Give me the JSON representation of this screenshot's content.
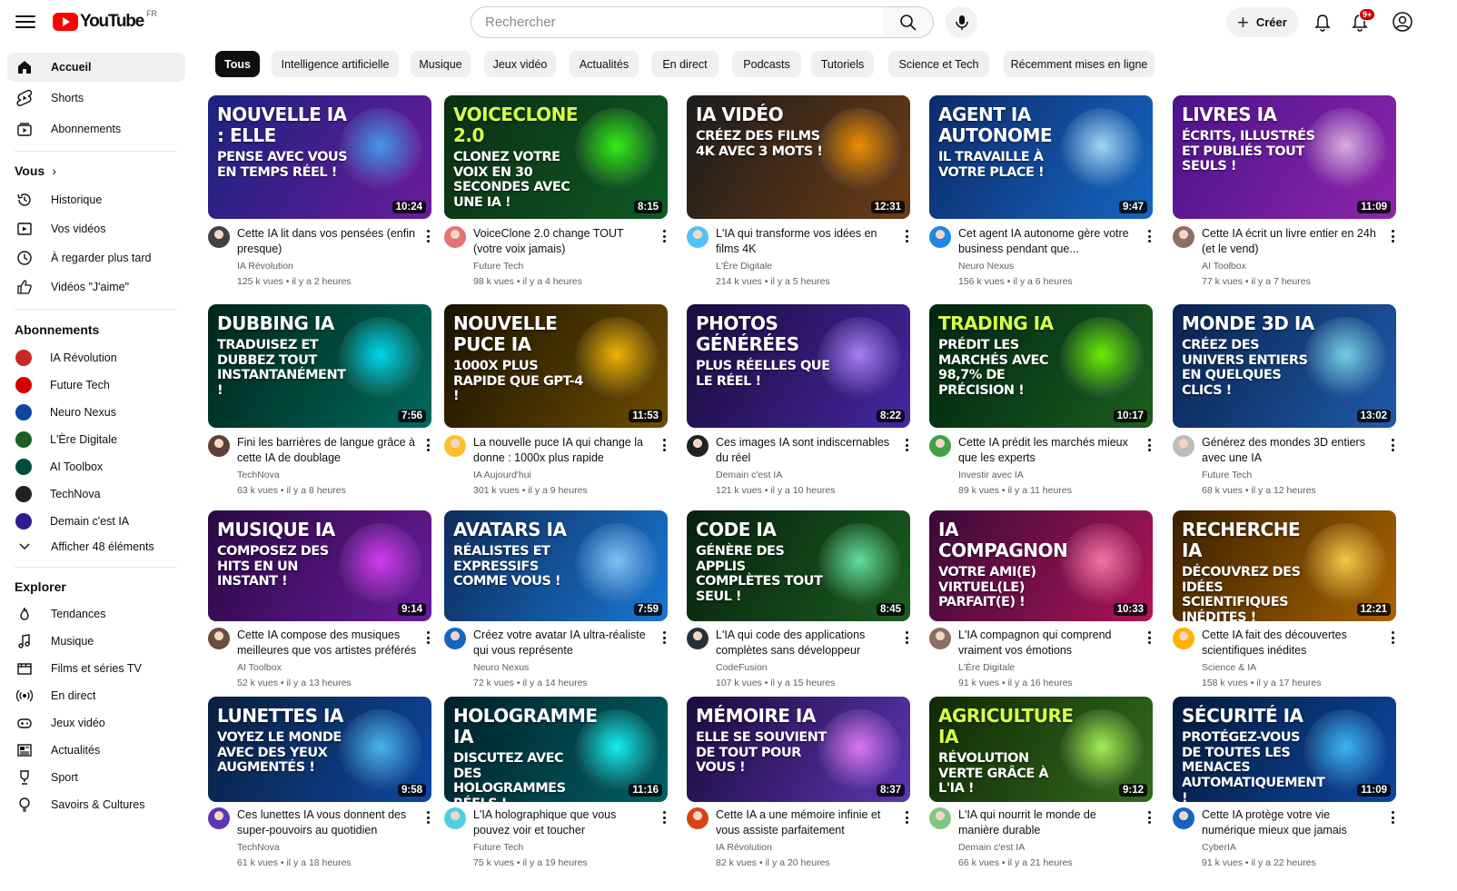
{
  "header": {
    "logo_text": "YouTube",
    "country_code": "FR",
    "search_placeholder": "Rechercher",
    "create_label": "Créer",
    "notification_count": "9+"
  },
  "sidebar": {
    "main": [
      {
        "label": "Accueil",
        "icon": "home-icon"
      },
      {
        "label": "Shorts",
        "icon": "shorts-icon"
      },
      {
        "label": "Abonnements",
        "icon": "subscriptions-icon"
      }
    ],
    "you_title": "Vous",
    "you": [
      {
        "label": "Historique",
        "icon": "history-icon"
      },
      {
        "label": "Vos vidéos",
        "icon": "your-videos-icon"
      },
      {
        "label": "À regarder plus tard",
        "icon": "watch-later-icon"
      },
      {
        "label": "Vidéos \"J'aime\"",
        "icon": "like-icon"
      }
    ],
    "subs_title": "Abonnements",
    "subs": [
      {
        "label": "IA Révolution",
        "color": "#c62828"
      },
      {
        "label": "Future Tech",
        "color": "#d50000"
      },
      {
        "label": "Neuro Nexus",
        "color": "#0d47a1"
      },
      {
        "label": "L'Ère Digitale",
        "color": "#1b5e20"
      },
      {
        "label": "AI Toolbox",
        "color": "#004d40"
      },
      {
        "label": "TechNova",
        "color": "#212121"
      },
      {
        "label": "Demain c'est IA",
        "color": "#311b92"
      }
    ],
    "show_more": "Afficher 48 éléments",
    "explore_title": "Explorer",
    "explore": [
      {
        "label": "Tendances",
        "icon": "trending-icon"
      },
      {
        "label": "Musique",
        "icon": "music-icon"
      },
      {
        "label": "Films et séries TV",
        "icon": "movies-icon"
      },
      {
        "label": "En direct",
        "icon": "live-icon"
      },
      {
        "label": "Jeux vidéo",
        "icon": "gaming-icon"
      },
      {
        "label": "Actualités",
        "icon": "news-icon"
      },
      {
        "label": "Sport",
        "icon": "sports-icon"
      },
      {
        "label": "Savoirs & Cultures",
        "icon": "learning-icon"
      }
    ]
  },
  "chips": [
    "Tous",
    "Intelligence artificielle",
    "Musique",
    "Jeux vidéo",
    "Actualités",
    "En direct",
    "Podcasts",
    "Tutoriels",
    "Science et Tech",
    "Récemment mises en ligne"
  ],
  "videos": [
    {
      "thumb_title": "Nouvelle IA : elle",
      "thumb_sub": "pense avec vous en temps réel !",
      "duration": "10:24",
      "title": "Cette IA lit dans vos pensées (enfin presque)",
      "channel": "IA Révolution",
      "stats": "125 k vues • il y a 2 heures",
      "bg": "#1a237e",
      "bg2": "#6a1b9a",
      "accent": "#42a5f5",
      "avatar": "#424242"
    },
    {
      "thumb_title": "VoiceClone 2.0",
      "thumb_sub": "Clonez votre voix en 30 secondes avec une IA !",
      "duration": "8:15",
      "title": "VoiceClone 2.0 change TOUT (votre voix jamais)",
      "channel": "Future Tech",
      "stats": "98 k vues • il y a 4 heures",
      "bg": "#0b2e13",
      "bg2": "#0f5a24",
      "accent": "#39ff14",
      "avatar": "#e57373"
    },
    {
      "thumb_title": "IA Vidéo",
      "thumb_sub": "Créez des films 4K avec 3 mots !",
      "duration": "12:31",
      "title": "L'IA qui transforme vos idées en films 4K",
      "channel": "L'Ère Digitale",
      "stats": "214 k vues • il y a 5 heures",
      "bg": "#1c1c1c",
      "bg2": "#6d3c14",
      "accent": "#ff9800",
      "avatar": "#4fc3f7"
    },
    {
      "thumb_title": "Agent IA autonome",
      "thumb_sub": "Il travaille à votre place !",
      "duration": "9:47",
      "title": "Cet agent IA autonome gère votre business pendant que...",
      "channel": "Neuro Nexus",
      "stats": "156 k vues • il y a 6 heures",
      "bg": "#0d2b6b",
      "bg2": "#1565c0",
      "accent": "#b3e5fc",
      "avatar": "#1e88e5"
    },
    {
      "thumb_title": "Livres IA",
      "thumb_sub": "Écrits, illustrés et publiés tout seuls !",
      "duration": "11:09",
      "title": "Cette IA écrit un livre entier en 24h (et le vend)",
      "channel": "AI Toolbox",
      "stats": "77 k vues • il y a 7 heures",
      "bg": "#4a148c",
      "bg2": "#8e24aa",
      "accent": "#e1bee7",
      "avatar": "#8d6e63"
    },
    {
      "thumb_title": "Dubbing IA",
      "thumb_sub": "Traduisez et dubbez tout instantanément !",
      "duration": "7:56",
      "title": "Fini les barrières de langue grâce à cette IA de doublage",
      "channel": "TechNova",
      "stats": "63 k vues • il y a 8 heures",
      "bg": "#00251a",
      "bg2": "#00695c",
      "accent": "#00e5ff",
      "avatar": "#5d4037"
    },
    {
      "thumb_title": "Nouvelle puce IA",
      "thumb_sub": "1000x plus rapide que GPT-4 !",
      "duration": "11:53",
      "title": "La nouvelle puce IA qui change la donne : 1000x plus rapide",
      "channel": "IA Aujourd'hui",
      "stats": "301 k vues • il y a 9 heures",
      "bg": "#1a1200",
      "bg2": "#6d4c00",
      "accent": "#ffc107",
      "avatar": "#fbc02d"
    },
    {
      "thumb_title": "Photos générées",
      "thumb_sub": "plus réelles que le réel !",
      "duration": "8:22",
      "title": "Ces images IA sont indiscernables du réel",
      "channel": "Demain c'est IA",
      "stats": "121 k vues • il y a 10 heures",
      "bg": "#1a0b3d",
      "bg2": "#4527a0",
      "accent": "#b388ff",
      "avatar": "#212121"
    },
    {
      "thumb_title": "Trading IA",
      "thumb_sub": "Prédit les marchés avec 98,7% de précision !",
      "duration": "10:17",
      "title": "Cette IA prédit les marchés mieux que les experts",
      "channel": "Investir avec IA",
      "stats": "89 k vues • il y a 11 heures",
      "bg": "#002510",
      "bg2": "#1b5e20",
      "accent": "#76ff03",
      "avatar": "#43a047"
    },
    {
      "thumb_title": "Monde 3D IA",
      "thumb_sub": "Créez des univers entiers en quelques clics !",
      "duration": "13:02",
      "title": "Générez des mondes 3D entiers avec une IA",
      "channel": "Future Tech",
      "stats": "68 k vues • il y a 12 heures",
      "bg": "#0a2350",
      "bg2": "#1e5aa8",
      "accent": "#80deea",
      "avatar": "#bdbdbd"
    },
    {
      "thumb_title": "Musique IA",
      "thumb_sub": "Composez des hits en un instant !",
      "duration": "9:14",
      "title": "Cette IA compose des musiques meilleures que vos artistes préférés",
      "channel": "AI Toolbox",
      "stats": "52 k vues • il y a 13 heures",
      "bg": "#2a0845",
      "bg2": "#6a1b9a",
      "accent": "#e040fb",
      "avatar": "#6d4c41"
    },
    {
      "thumb_title": "Avatars IA",
      "thumb_sub": "Réalistes et expressifs comme vous !",
      "duration": "7:59",
      "title": "Créez votre avatar IA ultra-réaliste qui vous représente",
      "channel": "Neuro Nexus",
      "stats": "72 k vues • il y a 14 heures",
      "bg": "#0d2b5a",
      "bg2": "#1976d2",
      "accent": "#90caf9",
      "avatar": "#1565c0"
    },
    {
      "thumb_title": "Code IA",
      "thumb_sub": "Génère des applis complètes tout seul !",
      "duration": "8:45",
      "title": "L'IA qui code des applications complètes sans développeur",
      "channel": "CodeFusion",
      "stats": "107 k vues • il y a 15 heures",
      "bg": "#06200e",
      "bg2": "#1b5e20",
      "accent": "#69f0ae",
      "avatar": "#263238"
    },
    {
      "thumb_title": "IA Compagnon",
      "thumb_sub": "Votre ami(e) virtuel(le) parfait(e) !",
      "duration": "10:33",
      "title": "L'IA compagnon qui comprend vraiment vos émotions",
      "channel": "L'Ère Digitale",
      "stats": "91 k vues • il y a 16 heures",
      "bg": "#3a0a3a",
      "bg2": "#ad1457",
      "accent": "#ff80ab",
      "avatar": "#8d6e63"
    },
    {
      "thumb_title": "Recherche IA",
      "thumb_sub": "Découvrez des idées scientifiques inédites !",
      "duration": "12:21",
      "title": "Cette IA fait des découvertes scientifiques inédites",
      "channel": "Science & IA",
      "stats": "158 k vues • il y a 17 heures",
      "bg": "#3a2000",
      "bg2": "#a86400",
      "accent": "#ffd54f",
      "avatar": "#ffb300"
    },
    {
      "thumb_title": "Lunettes IA",
      "thumb_sub": "Voyez le monde avec des yeux augmentés !",
      "duration": "9:58",
      "title": "Ces lunettes IA vous donnent des super-pouvoirs au quotidien",
      "channel": "TechNova",
      "stats": "61 k vues • il y a 18 heures",
      "bg": "#0a1f3d",
      "bg2": "#0d47a1",
      "accent": "#4fc3f7",
      "avatar": "#5e35b1"
    },
    {
      "thumb_title": "Hologramme IA",
      "thumb_sub": "Discutez avec des hologrammes réels !",
      "duration": "11:16",
      "title": "L'IA holographique que vous pouvez voir et toucher",
      "channel": "Future Tech",
      "stats": "75 k vues • il y a 19 heures",
      "bg": "#00202a",
      "bg2": "#006064",
      "accent": "#18ffff",
      "avatar": "#4dd0e1"
    },
    {
      "thumb_title": "Mémoire IA",
      "thumb_sub": "Elle se souvient de tout pour vous !",
      "duration": "8:37",
      "title": "Cette IA a une mémoire infinie et vous assiste parfaitement",
      "channel": "IA Révolution",
      "stats": "82 k vues • il y a 20 heures",
      "bg": "#1a0a3d",
      "bg2": "#5e35b1",
      "accent": "#ea80fc",
      "avatar": "#d84315"
    },
    {
      "thumb_title": "Agriculture IA",
      "thumb_sub": "Révolution verte grâce à l'IA !",
      "duration": "9:12",
      "title": "L'IA qui nourrit le monde de manière durable",
      "channel": "Demain c'est IA",
      "stats": "66 k vues • il y a 21 heures",
      "bg": "#102a05",
      "bg2": "#33691e",
      "accent": "#b2ff59",
      "avatar": "#81c784"
    },
    {
      "thumb_title": "Sécurité IA",
      "thumb_sub": "Protégez-vous de toutes les menaces automatiquement !",
      "duration": "11:09",
      "title": "Cette IA protège votre vie numérique mieux que jamais",
      "channel": "CyberIA",
      "stats": "91 k vues • il y a 22 heures",
      "bg": "#041a3a",
      "bg2": "#0d47a1",
      "accent": "#40c4ff",
      "avatar": "#1565c0"
    }
  ]
}
